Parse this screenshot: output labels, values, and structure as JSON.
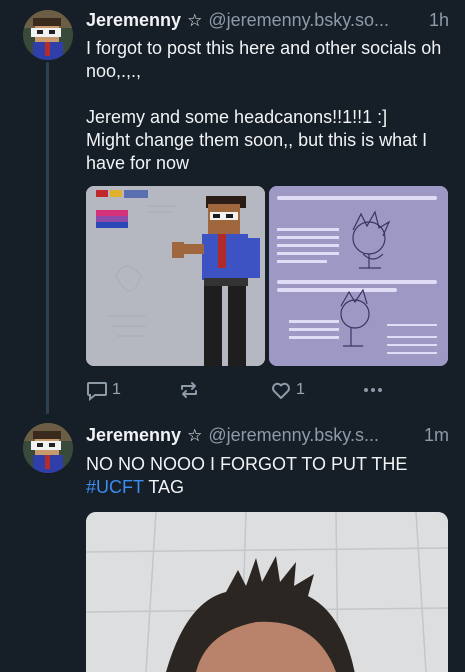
{
  "posts": [
    {
      "author": {
        "display_name": "Jeremenny",
        "badge": "☆",
        "handle": "@jeremenny.bsky.so...",
        "avatar_icon": "profile-avatar-icon"
      },
      "time": "1h",
      "text": "I forgot to post this here and other socials oh noo,.,.,\n\nJeremy and some headcanons!!1!!1 :]\nMight change them soon,, but this is what I have for now",
      "images": [
        {
          "name": "character-drawing-image"
        },
        {
          "name": "headcanon-notes-image"
        }
      ],
      "reply_count": "1",
      "repost_count": "",
      "like_count": "1"
    },
    {
      "author": {
        "display_name": "Jeremenny",
        "badge": "☆",
        "handle": "@jeremenny.bsky.s...",
        "avatar_icon": "profile-avatar-icon"
      },
      "time": "1m",
      "text_before": "NO NO NOOO I FORGOT TO PUT THE ",
      "hashtag": "#UCFT",
      "text_after": " TAG",
      "images": [
        {
          "name": "selfie-photo-image"
        }
      ]
    }
  ],
  "colors": {
    "background": "#161e27",
    "text": "#f1f3f5",
    "muted": "#8d9aa8",
    "link": "#3b8df0",
    "thread_line": "#2e4052"
  }
}
